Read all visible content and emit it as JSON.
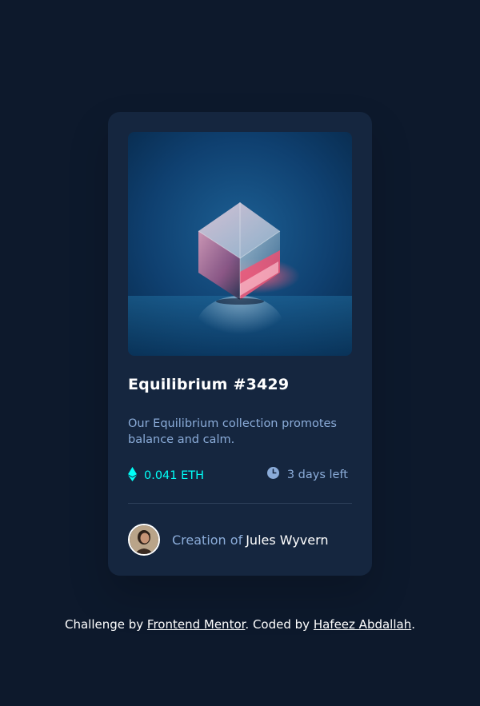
{
  "card": {
    "image_alt": "Equilibrium image",
    "title": "Equilibrium #3429",
    "description": "Our Equilibrium collection promotes balance and calm.",
    "price": "0.041 ETH",
    "time_left": "3 days left",
    "creator_prefix": "Creation of",
    "creator_name": "Jules Wyvern"
  },
  "attribution": {
    "prefix": "Challenge by ",
    "mentor_link": "Frontend Mentor",
    "middle": ". Coded by ",
    "author_link": "Hafeez Abdallah",
    "suffix": "."
  },
  "icons": {
    "eth": "ethereum-icon",
    "clock": "clock-icon"
  },
  "colors": {
    "background": "#0d192c",
    "card": "#15263f",
    "cyan": "#00fff8",
    "soft_blue": "#8bacd9",
    "white": "#ffffff"
  }
}
